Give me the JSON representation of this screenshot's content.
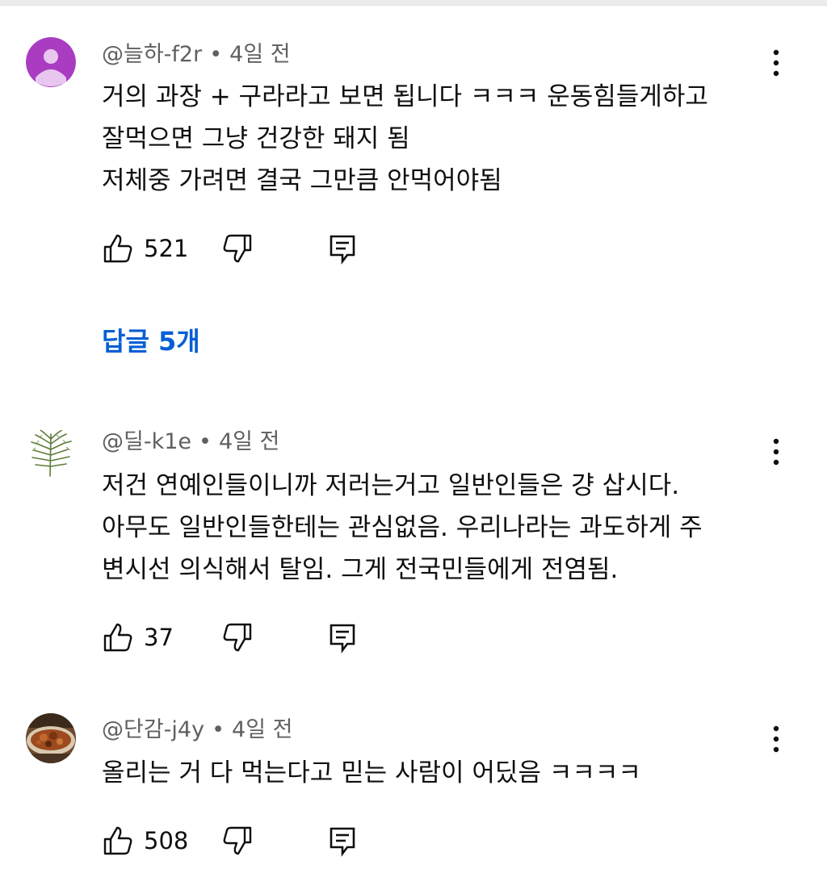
{
  "comments": [
    {
      "author": "@늘하-f2r",
      "time": "4일 전",
      "lines": [
        "거의 과장 + 구라라고 보면 됩니다 ㅋㅋㅋ 운동힘들게하고",
        "잘먹으면 그냥 건강한 돼지 됨",
        "저체중 가려면 결국 그만큼 안먹어야됨"
      ],
      "likes": "521",
      "replies_label": "답글 5개",
      "avatar": "default-person-icon",
      "avatar_color": "#a93cc1"
    },
    {
      "author": "@딜-k1e",
      "time": "4일 전",
      "lines": [
        "저건 연예인들이니까 저러는거고 일반인들은 걍 삽시다.",
        "아무도 일반인들한테는 관심없음. 우리나라는 과도하게 주",
        "변시선 의식해서 탈임. 그게 전국민들에게 전염됨."
      ],
      "likes": "37",
      "avatar": "dill-plant-image"
    },
    {
      "author": "@단감-j4y",
      "time": "4일 전",
      "lines": [
        "올리는 거 다 먹는다고 믿는 사람이 어딨음 ㅋㅋㅋㅋ"
      ],
      "likes": "508",
      "avatar": "food-dish-image"
    }
  ],
  "meta_separator": "•",
  "icons": {
    "like": "thumb-up-icon",
    "dislike": "thumb-down-icon",
    "reply": "reply-comment-icon",
    "more": "more-vertical-icon"
  },
  "colors": {
    "link": "#065fd4",
    "meta_text": "#606060",
    "body_text": "#0f0f0f"
  }
}
